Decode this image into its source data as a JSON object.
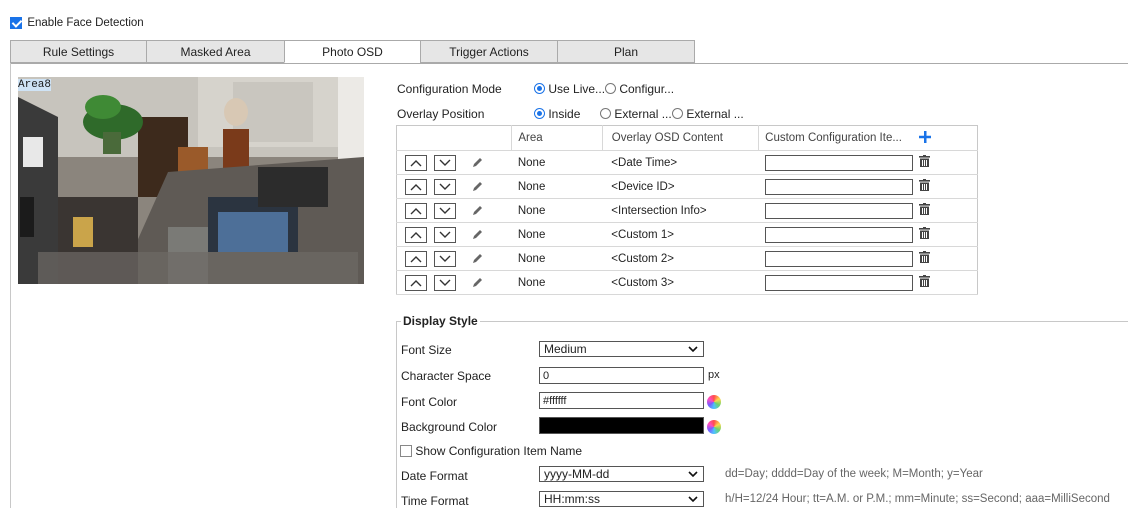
{
  "face_detection": {
    "label": "Enable Face Detection",
    "checked": true
  },
  "tabs": [
    {
      "label": "Rule Settings",
      "active": false
    },
    {
      "label": "Masked Area",
      "active": false
    },
    {
      "label": "Photo OSD",
      "active": true
    },
    {
      "label": "Trigger Actions",
      "active": false
    },
    {
      "label": "Plan",
      "active": false
    }
  ],
  "preview": {
    "area_label": "Area8"
  },
  "config_mode": {
    "label": "Configuration Mode",
    "option1": "Use Live...",
    "option2": "Configur...",
    "selected": "option1"
  },
  "overlay_position": {
    "label": "Overlay Position",
    "option1": "Inside",
    "option2": "External ...",
    "option3": "External ...",
    "selected": "option1"
  },
  "osd_table": {
    "headers": {
      "area": "Area",
      "content": "Overlay OSD Content",
      "custom": "Custom Configuration Ite..."
    },
    "rows": [
      {
        "area": "None",
        "content": "<Date Time>",
        "custom": ""
      },
      {
        "area": "None",
        "content": "<Device ID>",
        "custom": ""
      },
      {
        "area": "None",
        "content": "<Intersection Info>",
        "custom": ""
      },
      {
        "area": "None",
        "content": "<Custom 1>",
        "custom": ""
      },
      {
        "area": "None",
        "content": "<Custom 2>",
        "custom": ""
      },
      {
        "area": "None",
        "content": "<Custom 3>",
        "custom": ""
      }
    ]
  },
  "display_style": {
    "legend": "Display Style",
    "font_size": {
      "label": "Font Size",
      "value": "Medium"
    },
    "char_space": {
      "label": "Character Space",
      "value": "0",
      "unit": "px"
    },
    "font_color": {
      "label": "Font Color",
      "value": "#ffffff"
    },
    "bg_color": {
      "label": "Background Color",
      "value": "#000000"
    },
    "show_item_name": {
      "label": "Show Configuration Item Name",
      "checked": false
    },
    "date_format": {
      "label": "Date Format",
      "value": "yyyy-MM-dd",
      "hint": "dd=Day; dddd=Day of the week; M=Month; y=Year"
    },
    "time_format": {
      "label": "Time Format",
      "value": "HH:mm:ss",
      "hint": "h/H=12/24 Hour; tt=A.M. or P.M.; mm=Minute; ss=Second; aaa=MilliSecond"
    }
  },
  "colors": {
    "accent": "#1a73e8",
    "plus": "#1a73e8"
  }
}
